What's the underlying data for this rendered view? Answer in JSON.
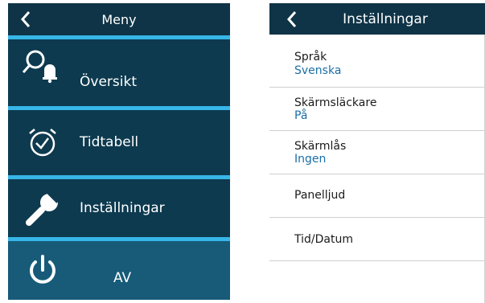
{
  "menu": {
    "title": "Meny",
    "items": [
      {
        "label": "Översikt"
      },
      {
        "label": "Tidtabell"
      },
      {
        "label": "Inställningar"
      },
      {
        "label": "AV"
      }
    ]
  },
  "settings": {
    "title": "Inställningar",
    "rows": [
      {
        "label": "Språk",
        "value": "Svenska"
      },
      {
        "label": "Skärmsläckare",
        "value": "På"
      },
      {
        "label": "Skärmlås",
        "value": "Ingen"
      },
      {
        "label": "Panelljud"
      },
      {
        "label": "Tid/Datum"
      }
    ]
  },
  "colors": {
    "panel_bg": "#0d3a4f",
    "header_bg": "#0f3447",
    "separator": "#37b6e8",
    "off_button_bg": "#175b79",
    "value_text": "#1a6fa6"
  }
}
